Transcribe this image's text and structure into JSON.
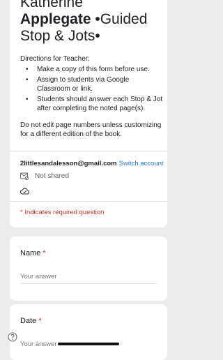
{
  "form": {
    "title_line1": "Katherine",
    "title_line2_bold": "Applegate",
    "title_line2_rest": " •Guided",
    "title_line3": "Stop & Jots•"
  },
  "description": {
    "heading": "Directions for Teacher:",
    "items": [
      "Make a copy of this form before use.",
      "Assign to students via Google Classroom or link.",
      "Students should answer each Stop & Jot after completing the noted page(s)."
    ],
    "footer": "Do not edit page numbers unless customizing for a different edition of the book."
  },
  "account": {
    "email": "2littlesandalesson@gmail.com",
    "switch_label": "Switch account",
    "share_status": "Not shared"
  },
  "required_note": "* Indicates required question",
  "questions": [
    {
      "label": "Name",
      "required_mark": "*",
      "placeholder": "Your answer"
    },
    {
      "label": "Date",
      "required_mark": "*",
      "placeholder": "Your answer"
    }
  ],
  "icons": {
    "share": "not-shared-icon",
    "cloud": "cloud-saved-icon",
    "help": "help-icon"
  },
  "colors": {
    "accent": "#1a73e8",
    "required": "#d93025",
    "background": "#ececec"
  }
}
